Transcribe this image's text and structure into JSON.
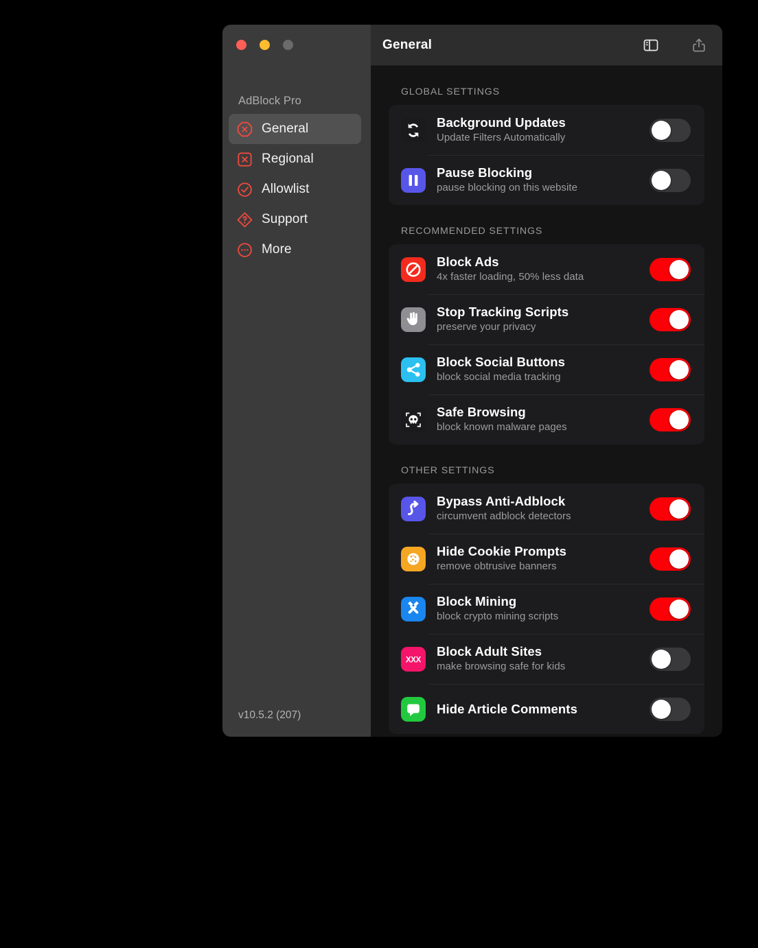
{
  "window": {
    "traffic_lights": [
      {
        "name": "close",
        "color": "#ff5f57"
      },
      {
        "name": "minimize",
        "color": "#febc2e"
      },
      {
        "name": "zoom",
        "color": "#6b6b6b"
      }
    ]
  },
  "sidebar": {
    "app_title": "AdBlock Pro",
    "version": "v10.5.2 (207)",
    "items": [
      {
        "label": "General",
        "icon": "octagon-x-icon",
        "selected": true
      },
      {
        "label": "Regional",
        "icon": "square-x-icon",
        "selected": false
      },
      {
        "label": "Allowlist",
        "icon": "check-circle-icon",
        "selected": false
      },
      {
        "label": "Support",
        "icon": "diamond-question-icon",
        "selected": false
      },
      {
        "label": "More",
        "icon": "ellipsis-circle-icon",
        "selected": false
      }
    ]
  },
  "header": {
    "title": "General",
    "sidebar_toggle_label": "sidebar-toggle",
    "share_label": "share"
  },
  "colors": {
    "accent_on": "#fb0007",
    "toggle_off": "#39393c",
    "sidebar_bg": "#3b3b3b",
    "main_bg": "#141414",
    "card_bg": "#1c1c1e",
    "titlebar_bg": "#2d2d2d",
    "selected_row": "#515151"
  },
  "sections": [
    {
      "id": "global",
      "header": "GLOBAL SETTINGS",
      "rows": [
        {
          "title": "Background Updates",
          "subtitle": "Update Filters Automatically",
          "icon": "refresh-icon",
          "icon_bg": "#1a1a1c",
          "icon_fg": "#ffffff",
          "toggle": "off"
        },
        {
          "title": "Pause Blocking",
          "subtitle": "pause blocking on this website",
          "icon": "pause-icon",
          "icon_bg": "#5856e8",
          "icon_fg": "#ffffff",
          "toggle": "off"
        }
      ]
    },
    {
      "id": "recommended",
      "header": "RECOMMENDED SETTINGS",
      "rows": [
        {
          "title": "Block Ads",
          "subtitle": "4x faster loading, 50% less data",
          "icon": "no-entry-icon",
          "icon_bg": "#f32b1e",
          "icon_fg": "#ffffff",
          "toggle": "on"
        },
        {
          "title": "Stop Tracking Scripts",
          "subtitle": "preserve your privacy",
          "icon": "hand-stop-icon",
          "icon_bg": "#8e8e93",
          "icon_fg": "#ffffff",
          "toggle": "on"
        },
        {
          "title": "Block Social Buttons",
          "subtitle": "block social media tracking",
          "icon": "share-nodes-icon",
          "icon_bg": "#2bc0f0",
          "icon_fg": "#ffffff",
          "toggle": "on"
        },
        {
          "title": "Safe Browsing",
          "subtitle": "block known malware pages",
          "icon": "skull-icon",
          "icon_bg": "#1a1a1c",
          "icon_fg": "#ffffff",
          "toggle": "on"
        }
      ]
    },
    {
      "id": "other",
      "header": "OTHER SETTINGS",
      "rows": [
        {
          "title": "Bypass Anti-Adblock",
          "subtitle": "circumvent adblock detectors",
          "icon": "detour-arrow-icon",
          "icon_bg": "#5856e8",
          "icon_fg": "#ffffff",
          "toggle": "on"
        },
        {
          "title": "Hide Cookie Prompts",
          "subtitle": "remove obtrusive banners",
          "icon": "cookie-icon",
          "icon_bg": "#f5a623",
          "icon_fg": "#ffffff",
          "toggle": "on"
        },
        {
          "title": "Block Mining",
          "subtitle": "block crypto mining scripts",
          "icon": "hammers-icon",
          "icon_bg": "#1a86ef",
          "icon_fg": "#ffffff",
          "toggle": "on"
        },
        {
          "title": "Block Adult Sites",
          "subtitle": "make browsing safe for kids",
          "icon": "xxx-icon",
          "icon_bg": "#f4146a",
          "icon_fg": "#ffffff",
          "icon_text": "XXX",
          "toggle": "off"
        },
        {
          "title": "Hide Article Comments",
          "subtitle": "",
          "icon": "comment-icon",
          "icon_bg": "#22c93f",
          "icon_fg": "#ffffff",
          "toggle": "off"
        }
      ]
    }
  ]
}
